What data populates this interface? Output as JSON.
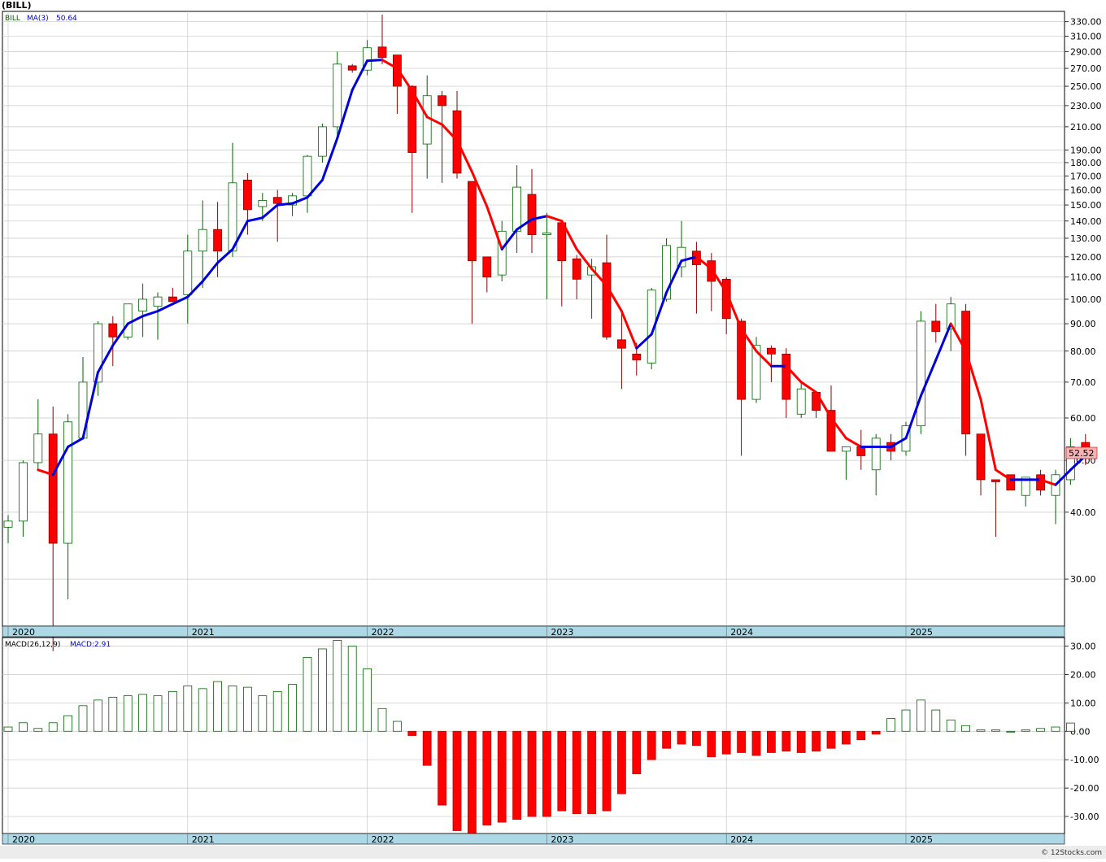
{
  "header": {
    "title": "(BILL)"
  },
  "legend": {
    "symbol": "BILL",
    "ma_label": "MA(3)",
    "ma_value": "50.64"
  },
  "macd_legend": {
    "label": "MACD(26,12,9)",
    "value_label": "MACD:2.91"
  },
  "last_price": "52.52",
  "watermark": "© 12Stocks.com",
  "colors": {
    "up": "#006400",
    "down": "#ff0000",
    "ma_up": "#0000dd",
    "ma_down": "#ff0000",
    "year_band": "#add8e6",
    "grid": "#c8c8c8"
  },
  "chart_data": [
    {
      "type": "candlestick",
      "title": "(BILL)",
      "scale": "log",
      "grid": true,
      "ylim": [
        24.5,
        345
      ],
      "yticks": [
        30,
        40,
        50,
        60,
        70,
        80,
        90,
        100,
        110,
        120,
        130,
        140,
        150,
        160,
        170,
        180,
        190,
        210,
        230,
        250,
        270,
        290,
        310,
        330
      ],
      "x_labels": [
        {
          "label": "2020",
          "index": 0
        },
        {
          "label": "2021",
          "index": 12
        },
        {
          "label": "2022",
          "index": 24
        },
        {
          "label": "2023",
          "index": 36
        },
        {
          "label": "2024",
          "index": 48
        },
        {
          "label": "2025",
          "index": 60
        }
      ],
      "series": [
        {
          "name": "BILL",
          "ohlc": [
            [
              37.5,
              39.5,
              35,
              38.5
            ],
            [
              38.5,
              50,
              36,
              49.5
            ],
            [
              49.5,
              65,
              48,
              56
            ],
            [
              56,
              63,
              22,
              35
            ],
            [
              35,
              61,
              27.5,
              59
            ],
            [
              55,
              78,
              55,
              70
            ],
            [
              70,
              91,
              66,
              90
            ],
            [
              90,
              93,
              75,
              85
            ],
            [
              85,
              96,
              84,
              98
            ],
            [
              95,
              107,
              85,
              100
            ],
            [
              97,
              103,
              84,
              101
            ],
            [
              101,
              105,
              99,
              99
            ],
            [
              102,
              132,
              90,
              123
            ],
            [
              123,
              153,
              105,
              135
            ],
            [
              135,
              152,
              110,
              123
            ],
            [
              123,
              196,
              120,
              165
            ],
            [
              167,
              172,
              132,
              147
            ],
            [
              149,
              158,
              140,
              153
            ],
            [
              155,
              160,
              128,
              151
            ],
            [
              150,
              158,
              143,
              156
            ],
            [
              156,
              186,
              145,
              185
            ],
            [
              185,
              213,
              180,
              210
            ],
            [
              210,
              290,
              200,
              275
            ],
            [
              273,
              275,
              265,
              268
            ],
            [
              268,
              305,
              262,
              295
            ],
            [
              296,
              340,
              275,
              283
            ],
            [
              286,
              286,
              222,
              250
            ],
            [
              250,
              251,
              145,
              188
            ],
            [
              195,
              262,
              168,
              240
            ],
            [
              240,
              245,
              165,
              230
            ],
            [
              225,
              245,
              168,
              172
            ],
            [
              166,
              166,
              90,
              118
            ],
            [
              120,
              120,
              103,
              110
            ],
            [
              111,
              140,
              108,
              134
            ],
            [
              134,
              178,
              122,
              162
            ],
            [
              157,
              175,
              122,
              132
            ],
            [
              132,
              145,
              100,
              133
            ],
            [
              139,
              139,
              97,
              118
            ],
            [
              119,
              121,
              100,
              109
            ],
            [
              111,
              119,
              92,
              115
            ],
            [
              117,
              132,
              84,
              85
            ],
            [
              84,
              95,
              68,
              81
            ],
            [
              79,
              83,
              72,
              77
            ],
            [
              76,
              105,
              74,
              104
            ],
            [
              100,
              130,
              99,
              126
            ],
            [
              115,
              140,
              110,
              125
            ],
            [
              123,
              128,
              94,
              116
            ],
            [
              118,
              122,
              95,
              108
            ],
            [
              109,
              110,
              86,
              92
            ],
            [
              91,
              92,
              51,
              65
            ],
            [
              65,
              85,
              64,
              82
            ],
            [
              81,
              82,
              70,
              79
            ],
            [
              79,
              81,
              60,
              65
            ],
            [
              61,
              70,
              60,
              68
            ],
            [
              67,
              67,
              60,
              62
            ],
            [
              62,
              69,
              52,
              52
            ],
            [
              52,
              53,
              46,
              53
            ],
            [
              53,
              57,
              48,
              51
            ],
            [
              48,
              56,
              43,
              55
            ],
            [
              54,
              56,
              50,
              52
            ],
            [
              52,
              59,
              51,
              58
            ],
            [
              58,
              95,
              56,
              91
            ],
            [
              91,
              98,
              83,
              87
            ],
            [
              88,
              101,
              80,
              98
            ],
            [
              95,
              98,
              51,
              56
            ],
            [
              56,
              56,
              43,
              46
            ],
            [
              46,
              46,
              36,
              45.6
            ],
            [
              47,
              47,
              44,
              44
            ],
            [
              43,
              46,
              41,
              46.5
            ],
            [
              47,
              48,
              43,
              44
            ],
            [
              43,
              48,
              38,
              47
            ],
            [
              46,
              55,
              45,
              53
            ],
            [
              54,
              56,
              49,
              52.52
            ]
          ]
        },
        {
          "name": "MA(3)",
          "values": [
            null,
            null,
            48,
            47,
            53,
            55,
            73,
            82,
            90,
            93,
            95,
            98,
            101,
            108,
            117,
            124,
            140,
            142,
            150,
            151,
            155,
            167,
            200,
            246,
            279,
            280,
            270,
            245,
            219,
            212,
            198,
            173,
            149,
            124,
            135,
            141,
            143,
            140,
            124,
            114,
            106,
            95,
            81,
            86,
            103,
            118,
            120,
            114,
            103,
            88,
            80,
            75,
            75,
            70,
            67,
            60,
            55,
            53,
            53,
            53,
            55,
            66,
            77,
            90,
            80,
            65,
            48,
            46,
            46,
            46,
            45,
            48,
            51
          ]
        }
      ]
    },
    {
      "type": "bar",
      "title": "MACD(26,12,9)",
      "grid": true,
      "ylim": [
        -36,
        33
      ],
      "yticks": [
        30,
        20,
        10,
        0,
        -10,
        -20,
        -30
      ],
      "x_labels": [
        {
          "label": "2020",
          "index": 0
        },
        {
          "label": "2021",
          "index": 12
        },
        {
          "label": "2022",
          "index": 24
        },
        {
          "label": "2023",
          "index": 36
        },
        {
          "label": "2024",
          "index": 48
        },
        {
          "label": "2025",
          "index": 60
        }
      ],
      "series": [
        {
          "name": "MACD",
          "values": [
            1.5,
            3,
            1,
            3,
            5.5,
            9,
            11,
            12,
            12.5,
            13,
            12.5,
            14,
            16,
            15,
            17.5,
            16,
            15.5,
            12.5,
            14,
            16.5,
            26,
            29,
            32,
            30,
            22,
            8,
            3.5,
            -1.5,
            -12,
            -26,
            -35,
            -36,
            -33,
            -32,
            -31,
            -30,
            -30,
            -28,
            -29,
            -29,
            -28,
            -22,
            -15,
            -10,
            -6,
            -4.5,
            -5,
            -9,
            -8,
            -7.5,
            -8.5,
            -7.5,
            -7,
            -7.5,
            -7,
            -6,
            -4.5,
            -3,
            -1,
            4.5,
            7.5,
            11,
            7.5,
            4,
            2,
            0.5,
            0.5,
            0,
            0.5,
            1,
            1.5,
            2.91
          ]
        }
      ]
    }
  ]
}
